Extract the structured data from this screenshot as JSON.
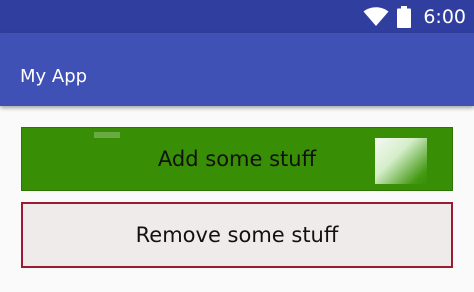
{
  "status_bar": {
    "time": "6:00",
    "icons": [
      "wifi-icon",
      "battery-icon"
    ],
    "color": "#303f9f"
  },
  "app_bar": {
    "title": "My App",
    "color": "#3f51b5"
  },
  "buttons": {
    "add_label": "Add some stuff",
    "add_color": "#388e05",
    "remove_label": "Remove some stuff",
    "remove_color": "#efebea",
    "remove_border_color": "#9c1b32"
  }
}
